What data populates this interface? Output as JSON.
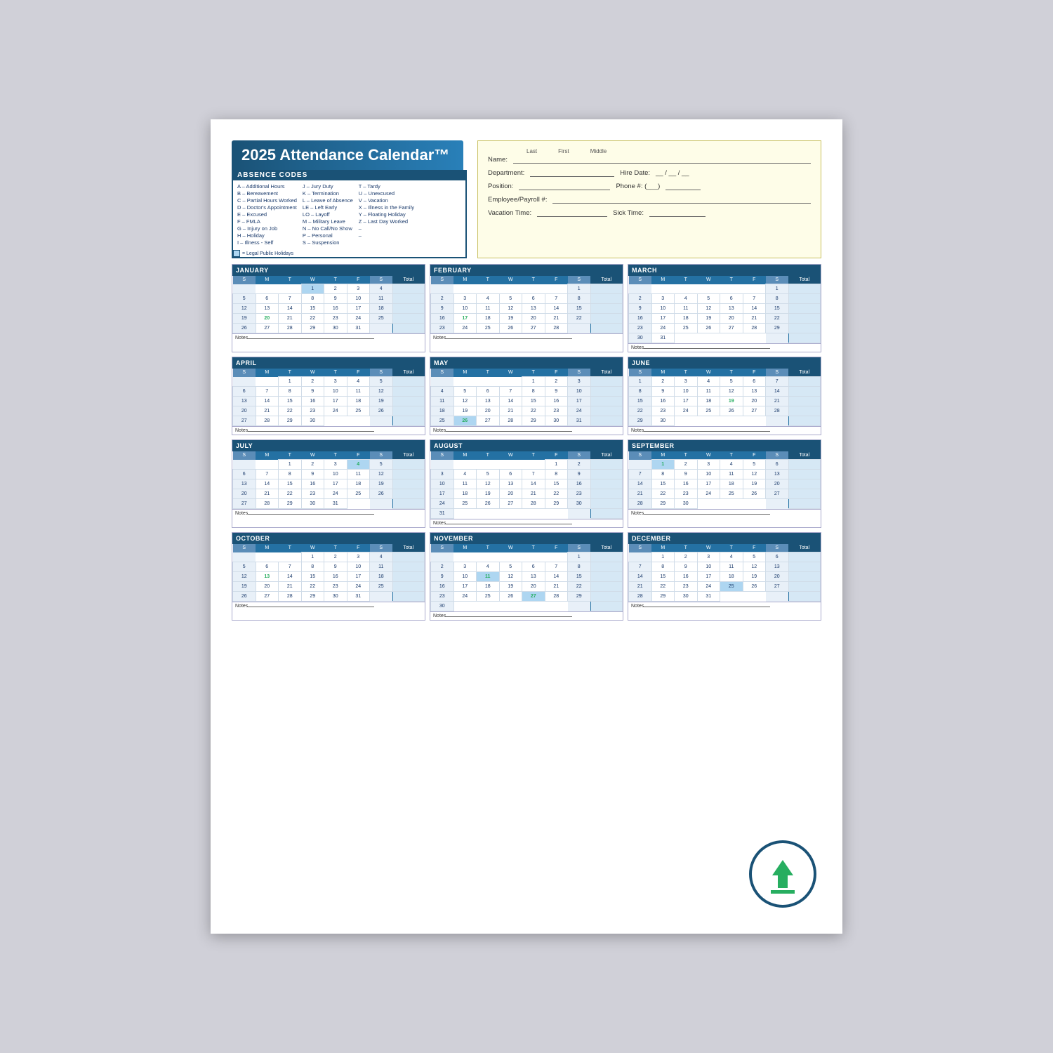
{
  "title": "2025 Attendance Calendar™",
  "absence_codes": {
    "header": "ABSENCE CODES",
    "col1": [
      "A – Additional Hours",
      "B – Bereavement",
      "C – Partial Hours Worked",
      "D – Doctor's Appointment",
      "E – Excused",
      "F – FMLA",
      "G – Injury on Job",
      "H – Holiday",
      "I  – Illness - Self"
    ],
    "col2": [
      "J  – Jury Duty",
      "K – Termination",
      "L  – Leave of Absence",
      "LE – Left Early",
      "LO – Layoff",
      "M – Military Leave",
      "N – No Call/No Show",
      "P  – Personal",
      "S  – Suspension"
    ],
    "col3": [
      "T – Tardy",
      "U – Unexcused",
      "V – Vacation",
      "X – Illness in the Family",
      "Y – Floating Holiday",
      "Z – Last Day Worked",
      "–",
      "–"
    ],
    "holiday_note": "= Legal Public Holidays"
  },
  "form_fields": {
    "name_label": "Name:",
    "name_last": "Last",
    "name_first": "First",
    "name_middle": "Middle",
    "dept_label": "Department:",
    "hire_label": "Hire Date:",
    "hire_format": "__ / __ / __",
    "position_label": "Position:",
    "phone_label": "Phone #: (___)",
    "employee_label": "Employee/Payroll #:",
    "vacation_label": "Vacation Time:",
    "sick_label": "Sick Time:"
  },
  "months": [
    {
      "name": "JANUARY",
      "days_header": [
        "S",
        "M",
        "T",
        "W",
        "T",
        "F",
        "S",
        "Total"
      ],
      "weeks": [
        [
          "",
          "",
          "",
          "1",
          "2",
          "3",
          "4",
          ""
        ],
        [
          "5",
          "6",
          "7",
          "8",
          "9",
          "10",
          "11",
          ""
        ],
        [
          "12",
          "13",
          "14",
          "15",
          "16",
          "17",
          "18",
          ""
        ],
        [
          "19",
          "20",
          "21",
          "22",
          "23",
          "24",
          "25",
          ""
        ],
        [
          "26",
          "27",
          "28",
          "29",
          "30",
          "31",
          "",
          ""
        ]
      ],
      "holidays": [
        "1"
      ],
      "marked": [
        "20"
      ],
      "weekend_cols": [
        0,
        6
      ]
    },
    {
      "name": "FEBRUARY",
      "days_header": [
        "S",
        "M",
        "T",
        "W",
        "T",
        "F",
        "S",
        "Total"
      ],
      "weeks": [
        [
          "",
          "",
          "",
          "",
          "",
          "",
          "1",
          ""
        ],
        [
          "2",
          "3",
          "4",
          "5",
          "6",
          "7",
          "8",
          ""
        ],
        [
          "9",
          "10",
          "11",
          "12",
          "13",
          "14",
          "15",
          ""
        ],
        [
          "16",
          "17",
          "18",
          "19",
          "20",
          "21",
          "22",
          ""
        ],
        [
          "23",
          "24",
          "25",
          "26",
          "27",
          "28",
          "",
          ""
        ]
      ],
      "holidays": [],
      "marked": [
        "17"
      ],
      "weekend_cols": [
        0,
        6
      ]
    },
    {
      "name": "MARCH",
      "days_header": [
        "S",
        "M",
        "T",
        "W",
        "T",
        "F",
        "S",
        "Total"
      ],
      "weeks": [
        [
          "",
          "",
          "",
          "",
          "",
          "",
          "1",
          ""
        ],
        [
          "2",
          "3",
          "4",
          "5",
          "6",
          "7",
          "8",
          ""
        ],
        [
          "9",
          "10",
          "11",
          "12",
          "13",
          "14",
          "15",
          ""
        ],
        [
          "16",
          "17",
          "18",
          "19",
          "20",
          "21",
          "22",
          ""
        ],
        [
          "23",
          "24",
          "25",
          "26",
          "27",
          "28",
          "29",
          ""
        ],
        [
          "30",
          "31",
          "",
          "",
          "",
          "",
          "",
          ""
        ]
      ],
      "holidays": [],
      "marked": [],
      "weekend_cols": [
        0,
        6
      ]
    },
    {
      "name": "APRIL",
      "days_header": [
        "S",
        "M",
        "T",
        "W",
        "T",
        "F",
        "S",
        "Total"
      ],
      "weeks": [
        [
          "",
          "",
          "1",
          "2",
          "3",
          "4",
          "5",
          ""
        ],
        [
          "6",
          "7",
          "8",
          "9",
          "10",
          "11",
          "12",
          ""
        ],
        [
          "13",
          "14",
          "15",
          "16",
          "17",
          "18",
          "19",
          ""
        ],
        [
          "20",
          "21",
          "22",
          "23",
          "24",
          "25",
          "26",
          ""
        ],
        [
          "27",
          "28",
          "29",
          "30",
          "",
          "",
          "",
          ""
        ]
      ],
      "holidays": [],
      "marked": [],
      "weekend_cols": [
        0,
        6
      ]
    },
    {
      "name": "MAY",
      "days_header": [
        "S",
        "M",
        "T",
        "W",
        "T",
        "F",
        "S",
        "Total"
      ],
      "weeks": [
        [
          "",
          "",
          "",
          "",
          "1",
          "2",
          "3",
          ""
        ],
        [
          "4",
          "5",
          "6",
          "7",
          "8",
          "9",
          "10",
          ""
        ],
        [
          "11",
          "12",
          "13",
          "14",
          "15",
          "16",
          "17",
          ""
        ],
        [
          "18",
          "19",
          "20",
          "21",
          "22",
          "23",
          "24",
          ""
        ],
        [
          "25",
          "26",
          "27",
          "28",
          "29",
          "30",
          "31",
          ""
        ]
      ],
      "holidays": [
        "26"
      ],
      "marked": [
        "26"
      ],
      "weekend_cols": [
        0,
        6
      ]
    },
    {
      "name": "JUNE",
      "days_header": [
        "S",
        "M",
        "T",
        "W",
        "T",
        "F",
        "S",
        "Total"
      ],
      "weeks": [
        [
          "1",
          "2",
          "3",
          "4",
          "5",
          "6",
          "7",
          ""
        ],
        [
          "8",
          "9",
          "10",
          "11",
          "12",
          "13",
          "14",
          ""
        ],
        [
          "15",
          "16",
          "17",
          "18",
          "19",
          "20",
          "21",
          ""
        ],
        [
          "22",
          "23",
          "24",
          "25",
          "26",
          "27",
          "28",
          ""
        ],
        [
          "29",
          "30",
          "",
          "",
          "",
          "",
          "",
          ""
        ]
      ],
      "holidays": [],
      "marked": [
        "19"
      ],
      "weekend_cols": [
        0,
        6
      ]
    },
    {
      "name": "JULY",
      "days_header": [
        "S",
        "M",
        "T",
        "W",
        "T",
        "F",
        "S",
        "Total"
      ],
      "weeks": [
        [
          "",
          "",
          "1",
          "2",
          "3",
          "4",
          "5",
          ""
        ],
        [
          "6",
          "7",
          "8",
          "9",
          "10",
          "11",
          "12",
          ""
        ],
        [
          "13",
          "14",
          "15",
          "16",
          "17",
          "18",
          "19",
          ""
        ],
        [
          "20",
          "21",
          "22",
          "23",
          "24",
          "25",
          "26",
          ""
        ],
        [
          "27",
          "28",
          "29",
          "30",
          "31",
          "",
          "",
          ""
        ]
      ],
      "holidays": [
        "4"
      ],
      "marked": [
        "4"
      ],
      "weekend_cols": [
        0,
        6
      ]
    },
    {
      "name": "AUGUST",
      "days_header": [
        "S",
        "M",
        "T",
        "W",
        "T",
        "F",
        "S",
        "Total"
      ],
      "weeks": [
        [
          "",
          "",
          "",
          "",
          "",
          "1",
          "2",
          ""
        ],
        [
          "3",
          "4",
          "5",
          "6",
          "7",
          "8",
          "9",
          ""
        ],
        [
          "10",
          "11",
          "12",
          "13",
          "14",
          "15",
          "16",
          ""
        ],
        [
          "17",
          "18",
          "19",
          "20",
          "21",
          "22",
          "23",
          ""
        ],
        [
          "24",
          "25",
          "26",
          "27",
          "28",
          "29",
          "30",
          ""
        ],
        [
          "31",
          "",
          "",
          "",
          "",
          "",
          "",
          ""
        ]
      ],
      "holidays": [],
      "marked": [],
      "weekend_cols": [
        0,
        6
      ]
    },
    {
      "name": "SEPTEMBER",
      "days_header": [
        "S",
        "M",
        "T",
        "W",
        "T",
        "F",
        "S",
        "Total"
      ],
      "weeks": [
        [
          "",
          "1",
          "2",
          "3",
          "4",
          "5",
          "6",
          ""
        ],
        [
          "7",
          "8",
          "9",
          "10",
          "11",
          "12",
          "13",
          ""
        ],
        [
          "14",
          "15",
          "16",
          "17",
          "18",
          "19",
          "20",
          ""
        ],
        [
          "21",
          "22",
          "23",
          "24",
          "25",
          "26",
          "27",
          ""
        ],
        [
          "28",
          "29",
          "30",
          "",
          "",
          "",
          "",
          ""
        ]
      ],
      "holidays": [
        "1"
      ],
      "marked": [
        "1"
      ],
      "weekend_cols": [
        0,
        6
      ]
    },
    {
      "name": "OCTOBER",
      "days_header": [
        "S",
        "M",
        "T",
        "W",
        "T",
        "F",
        "S",
        "Total"
      ],
      "weeks": [
        [
          "",
          "",
          "",
          "1",
          "2",
          "3",
          "4",
          ""
        ],
        [
          "5",
          "6",
          "7",
          "8",
          "9",
          "10",
          "11",
          ""
        ],
        [
          "12",
          "13",
          "14",
          "15",
          "16",
          "17",
          "18",
          ""
        ],
        [
          "19",
          "20",
          "21",
          "22",
          "23",
          "24",
          "25",
          ""
        ],
        [
          "26",
          "27",
          "28",
          "29",
          "30",
          "31",
          "",
          ""
        ]
      ],
      "holidays": [],
      "marked": [
        "13"
      ],
      "weekend_cols": [
        0,
        6
      ]
    },
    {
      "name": "NOVEMBER",
      "days_header": [
        "S",
        "M",
        "T",
        "W",
        "T",
        "F",
        "S",
        "Total"
      ],
      "weeks": [
        [
          "",
          "",
          "",
          "",
          "",
          "",
          "1",
          ""
        ],
        [
          "2",
          "3",
          "4",
          "5",
          "6",
          "7",
          "8",
          ""
        ],
        [
          "9",
          "10",
          "11",
          "12",
          "13",
          "14",
          "15",
          ""
        ],
        [
          "16",
          "17",
          "18",
          "19",
          "20",
          "21",
          "22",
          ""
        ],
        [
          "23",
          "24",
          "25",
          "26",
          "27",
          "28",
          "29",
          ""
        ],
        [
          "30",
          "",
          "",
          "",
          "",
          "",
          "",
          ""
        ]
      ],
      "holidays": [
        "11",
        "27"
      ],
      "marked": [
        "11",
        "27"
      ],
      "weekend_cols": [
        0,
        6
      ]
    },
    {
      "name": "DECEMBER",
      "days_header": [
        "S",
        "M",
        "T",
        "W",
        "T",
        "F",
        "S",
        "Total"
      ],
      "weeks": [
        [
          "",
          "1",
          "2",
          "3",
          "4",
          "5",
          "6",
          ""
        ],
        [
          "7",
          "8",
          "9",
          "10",
          "11",
          "12",
          "13",
          ""
        ],
        [
          "14",
          "15",
          "16",
          "17",
          "18",
          "19",
          "20",
          ""
        ],
        [
          "21",
          "22",
          "23",
          "24",
          "25",
          "26",
          "27",
          ""
        ],
        [
          "28",
          "29",
          "30",
          "31",
          "",
          "",
          "",
          ""
        ]
      ],
      "holidays": [
        "25"
      ],
      "marked": [],
      "weekend_cols": [
        0,
        6
      ]
    }
  ],
  "notes_label": "Notes"
}
